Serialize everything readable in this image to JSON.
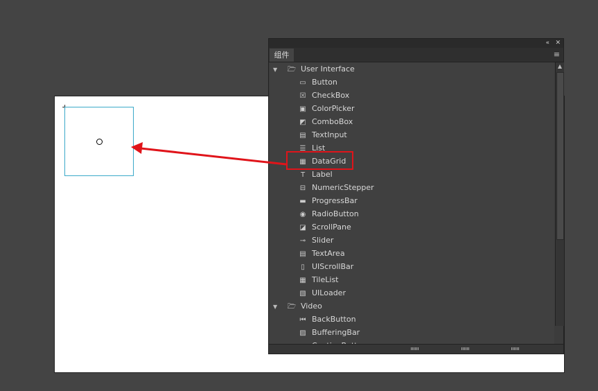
{
  "panel": {
    "tab_label": "组件",
    "collapse_icon": "«",
    "close_icon": "✕",
    "menu_icon": "≡"
  },
  "tree": [
    {
      "type": "folder",
      "label": "User Interface",
      "items": [
        "Button",
        "CheckBox",
        "ColorPicker",
        "ComboBox",
        "TextInput",
        "List",
        "DataGrid",
        "Label",
        "NumericStepper",
        "ProgressBar",
        "RadioButton",
        "ScrollPane",
        "Slider",
        "TextArea",
        "UIScrollBar",
        "TileList",
        "UILoader"
      ]
    },
    {
      "type": "folder",
      "label": "Video",
      "items": [
        "BackButton",
        "BufferingBar",
        "CaptionButton"
      ]
    }
  ],
  "highlighted_item": "DataGrid",
  "colors": {
    "highlight": "#e0141a",
    "symbol_outline": "#3aa9c9"
  }
}
